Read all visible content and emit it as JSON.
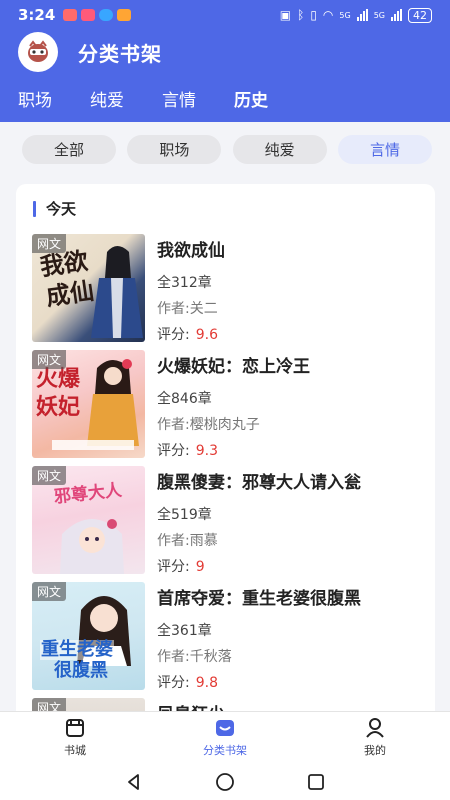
{
  "status": {
    "time": "3:24",
    "signal_label_1": "5G",
    "signal_label_2": "5G",
    "battery": "42"
  },
  "app": {
    "title": "分类书架"
  },
  "top_tabs": [
    {
      "label": "职场"
    },
    {
      "label": "纯爱"
    },
    {
      "label": "言情"
    },
    {
      "label": "历史",
      "active": true
    }
  ],
  "chips": [
    {
      "label": "全部"
    },
    {
      "label": "职场"
    },
    {
      "label": "纯爱"
    },
    {
      "label": "言情",
      "active": true
    }
  ],
  "section": {
    "title": "今天"
  },
  "books": [
    {
      "title": "我欲成仙",
      "chapters": "全312章",
      "author_label": "作者:",
      "author": "关二",
      "score_label": "评分:",
      "score": "9.6",
      "tag": "网文"
    },
    {
      "title": "火爆妖妃：恋上冷王",
      "chapters": "全846章",
      "author_label": "作者:",
      "author": "樱桃肉丸子",
      "score_label": "评分:",
      "score": "9.3",
      "tag": "网文"
    },
    {
      "title": "腹黑傻妻：邪尊大人请入瓮",
      "chapters": "全519章",
      "author_label": "作者:",
      "author": "雨慕",
      "score_label": "评分:",
      "score": "9",
      "tag": "网文"
    },
    {
      "title": "首席夺爱：重生老婆很腹黑",
      "chapters": "全361章",
      "author_label": "作者:",
      "author": "千秋落",
      "score_label": "评分:",
      "score": "9.8",
      "tag": "网文"
    },
    {
      "title": "凤皇狂少",
      "tag": "网文"
    }
  ],
  "bottom_nav": [
    {
      "label": "书城",
      "icon": "book-city-icon"
    },
    {
      "label": "分类书架",
      "icon": "bookshelf-icon",
      "active": true
    },
    {
      "label": "我的",
      "icon": "profile-icon"
    }
  ],
  "colors": {
    "brand": "#4e68e6",
    "score": "#e23b35"
  }
}
